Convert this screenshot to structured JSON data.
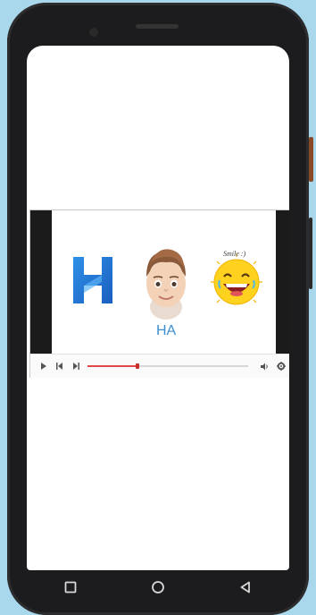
{
  "video": {
    "caption": "HA",
    "sticker_text": "Smile :)",
    "progress": 0.31
  },
  "icons": {
    "play": "play-icon",
    "prev": "skip-back-icon",
    "next": "skip-forward-icon",
    "volume": "volume-icon",
    "settings": "settings-icon"
  },
  "colors": {
    "logo_blue": "#1f6fd1",
    "progress": "#e0484a",
    "caption": "#3b8ed0"
  }
}
